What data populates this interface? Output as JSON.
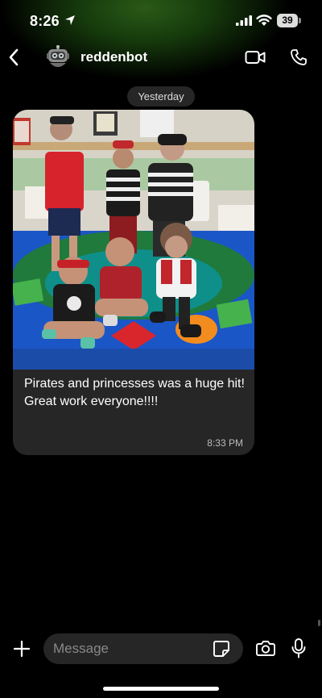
{
  "status_bar": {
    "time": "8:26",
    "battery_level": "39"
  },
  "header": {
    "contact_name": "reddenbot",
    "icons": {
      "back": "back-chevron-icon",
      "avatar": "robot-avatar",
      "video": "video-call-icon",
      "phone": "phone-call-icon"
    }
  },
  "conversation": {
    "date_separator": "Yesterday",
    "messages": [
      {
        "text": "Pirates and princesses was a huge hit! Great work everyone!!!!",
        "time": "8:33 PM",
        "has_photo": true
      }
    ]
  },
  "composer": {
    "placeholder": "Message",
    "icons": {
      "attach": "plus-icon",
      "sticker": "sticker-icon",
      "camera": "camera-icon",
      "mic": "microphone-icon"
    }
  },
  "colors": {
    "background": "#000000",
    "bubble": "#262626",
    "placeholder": "#888888"
  }
}
